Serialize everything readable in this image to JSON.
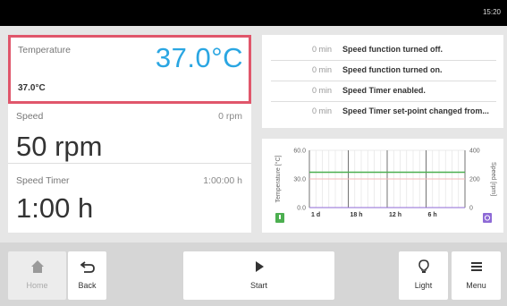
{
  "status_bar": {
    "clock": "15:20"
  },
  "temperature": {
    "label": "Temperature",
    "value": "37.0°C",
    "setpoint": "37.0°C"
  },
  "speed": {
    "label": "Speed",
    "unit_value": "0 rpm",
    "value": "50 rpm"
  },
  "speed_timer": {
    "label": "Speed Timer",
    "setpoint": "1:00:00 h",
    "value": "1:00 h"
  },
  "event_log": [
    {
      "time": "0 min",
      "message": "Speed function turned off."
    },
    {
      "time": "0 min",
      "message": "Speed function turned on."
    },
    {
      "time": "0 min",
      "message": "Speed Timer enabled."
    },
    {
      "time": "0 min",
      "message": "Speed Timer set-point changed from..."
    }
  ],
  "chart_data": {
    "type": "line",
    "x_tick_labels": [
      "1 d",
      "18 h",
      "12 h",
      "6 h"
    ],
    "y_left": {
      "label": "Temperature [°C]",
      "ticks": [
        "60.0",
        "30.0",
        "0.0"
      ],
      "range": [
        0,
        60
      ]
    },
    "y_right": {
      "label": "Speed [rpm]",
      "ticks": [
        "400",
        "200",
        "0"
      ],
      "range": [
        0,
        400
      ]
    },
    "grid": true,
    "series": [
      {
        "color": "#4caf50",
        "values": [
          37,
          37,
          37,
          37,
          37
        ]
      },
      {
        "color": "#f2b8b8",
        "values": [
          30,
          30,
          30,
          30,
          30
        ]
      },
      {
        "color": "#8e6ad6",
        "values": [
          0,
          0,
          0,
          0,
          0
        ]
      }
    ],
    "colors": {
      "temp_icon": "#4caf50",
      "speed_icon": "#8e6ad6"
    }
  },
  "bottom_bar": {
    "home": {
      "label": "Home",
      "icon": "home-icon"
    },
    "back": {
      "label": "Back",
      "icon": "back-arrow-icon"
    },
    "start": {
      "label": "Start",
      "icon": "play-icon"
    },
    "light": {
      "label": "Light",
      "icon": "lightbulb-icon"
    },
    "menu": {
      "label": "Menu",
      "icon": "hamburger-icon"
    }
  },
  "colors": {
    "accent": "#2aa6e2",
    "highlight_border": "#e0566b"
  }
}
